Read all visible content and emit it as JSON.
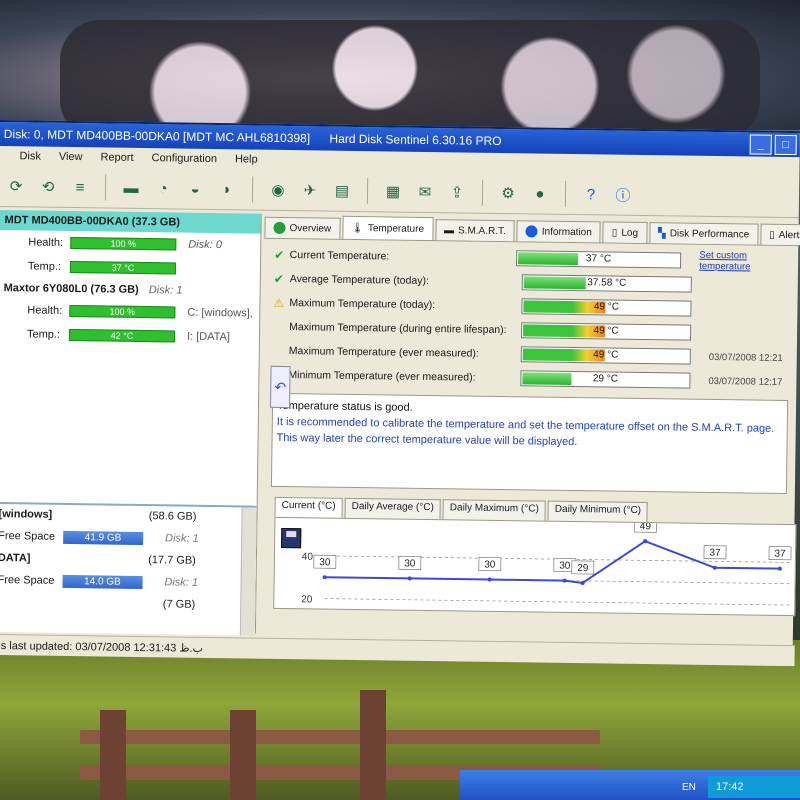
{
  "window": {
    "title": "Disk: 0, MDT MD400BB-00DKA0 [MDT MC AHL6810398]",
    "app_name": "Hard Disk Sentinel 6.30.16 PRO",
    "buttons": [
      "_",
      "□",
      "×"
    ]
  },
  "menu": [
    "Disk",
    "View",
    "Report",
    "Configuration",
    "Help"
  ],
  "disks": [
    {
      "name": "MDT MD400BB-00DKA0 (37.3 GB)",
      "note": "Disk: 0",
      "health_label": "Health:",
      "health": "100 %",
      "health_pct": 100,
      "temp_label": "Temp.:",
      "temp": "37 °C",
      "health_extra": "Disk: 0",
      "temp_extra": ""
    },
    {
      "name": "Maxtor 6Y080L0 (76.3 GB)",
      "note": "Disk: 1",
      "health_label": "Health:",
      "health": "100 %",
      "health_pct": 100,
      "temp_label": "Temp.:",
      "temp": "42 °C",
      "health_extra": "C: [windows],",
      "temp_extra": "I: [DATA]"
    }
  ],
  "partitions": [
    {
      "name": "[windows]",
      "size": "(58.6 GB)",
      "free_label": "Free Space",
      "free": "41.9 GB",
      "disk": "Disk: 1"
    },
    {
      "name": "DATA]",
      "size": "(17.7 GB)",
      "free_label": "Free Space",
      "free": "14.0 GB",
      "disk": "Disk: 1"
    },
    {
      "name": "",
      "size": "(7 GB)",
      "free_label": "",
      "free": "",
      "disk": ""
    }
  ],
  "tabs": [
    {
      "label": "Overview",
      "active": false,
      "icon_color": "#2a9a3a"
    },
    {
      "label": "Temperature",
      "active": true,
      "icon_color": ""
    },
    {
      "label": "S.M.A.R.T.",
      "active": false,
      "icon_color": ""
    },
    {
      "label": "Information",
      "active": false,
      "icon_color": "#1e5ad8"
    },
    {
      "label": "Log",
      "active": false,
      "icon_color": ""
    },
    {
      "label": "Disk Performance",
      "active": false,
      "icon_color": ""
    },
    {
      "label": "Alerts",
      "active": false,
      "icon_color": ""
    }
  ],
  "temperatures": [
    {
      "name": "Current Temperature:",
      "value": "37 °C",
      "fill": 0.37,
      "warm": false,
      "icon": "check",
      "side": "Set custom temperature",
      "side_link": true
    },
    {
      "name": "Average Temperature (today):",
      "value": "37.58 °C",
      "fill": 0.37,
      "warm": false,
      "icon": "check",
      "side": "",
      "side_link": false
    },
    {
      "name": "Maximum Temperature (today):",
      "value": "49 °C",
      "fill": 0.49,
      "warm": true,
      "icon": "warning",
      "side": "",
      "side_link": false
    },
    {
      "name": "Maximum Temperature (during entire lifespan):",
      "value": "49 °C",
      "fill": 0.49,
      "warm": true,
      "icon": "",
      "side": "",
      "side_link": false
    },
    {
      "name": "Maximum Temperature (ever measured):",
      "value": "49 °C",
      "fill": 0.49,
      "warm": true,
      "icon": "",
      "side": "03/07/2008 12:21",
      "side_link": false
    },
    {
      "name": "Minimum Temperature (ever measured):",
      "value": "29 °C",
      "fill": 0.29,
      "warm": false,
      "icon": "",
      "side": "03/07/2008 12:17",
      "side_link": false
    }
  ],
  "status": {
    "line1": "Temperature status is good.",
    "line2": "It is recommended to calibrate the temperature and set the temperature offset on the S.M.A.R.T. page.",
    "line3": "This way later the correct temperature value will be displayed."
  },
  "graph_tabs": [
    "Current (°C)",
    "Daily Average (°C)",
    "Daily Maximum (°C)",
    "Daily Minimum (°C)"
  ],
  "chart_data": {
    "type": "line",
    "ylim": [
      20,
      50
    ],
    "ytick_labels": [
      "40",
      "20"
    ],
    "values": [
      30,
      30,
      30,
      30,
      29,
      49,
      37,
      37
    ],
    "series": [
      {
        "values": [
          30,
          30,
          30,
          30,
          29,
          49,
          37,
          37
        ]
      }
    ]
  },
  "statusbar": "us last updated: 03/07/2008 12:31:43 ب.ظ",
  "taskbar": {
    "lang": "EN",
    "clock": "17:42"
  },
  "colors": {
    "title_bar": "#1e50c8",
    "selected_disk": "#6dd8d0",
    "good": "#2fbf2f",
    "link": "#1b3fb8",
    "chart_line": "#3a4ad8"
  }
}
